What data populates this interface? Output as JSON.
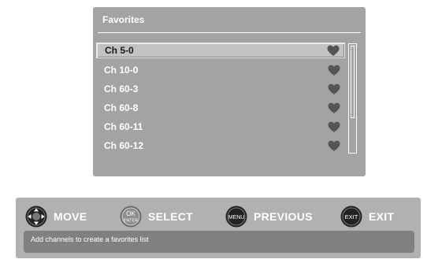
{
  "favorites": {
    "title": "Favorites",
    "channels": [
      {
        "label": "Ch 5-0",
        "selected": true
      },
      {
        "label": "Ch 10-0",
        "selected": false
      },
      {
        "label": "Ch 60-3",
        "selected": false
      },
      {
        "label": "Ch 60-8",
        "selected": false
      },
      {
        "label": "Ch 60-11",
        "selected": false
      },
      {
        "label": "Ch 60-12",
        "selected": false
      }
    ]
  },
  "legend": {
    "move_label": "MOVE",
    "ok_icon_top": "OK",
    "ok_icon_bottom": "ENTER",
    "select_label": "SELECT",
    "menu_icon_text": "MENU",
    "previous_label": "PREVIOUS",
    "exit_icon_text": "EXIT",
    "exit_label": "EXIT"
  },
  "status": {
    "message": "Add channels to create a favorites list"
  },
  "colors": {
    "panel": "#a3a3a3",
    "selected_row": "#c2c2c2",
    "heart": "#555555",
    "bar": "#b1b1b1",
    "status_box": "#808080"
  }
}
